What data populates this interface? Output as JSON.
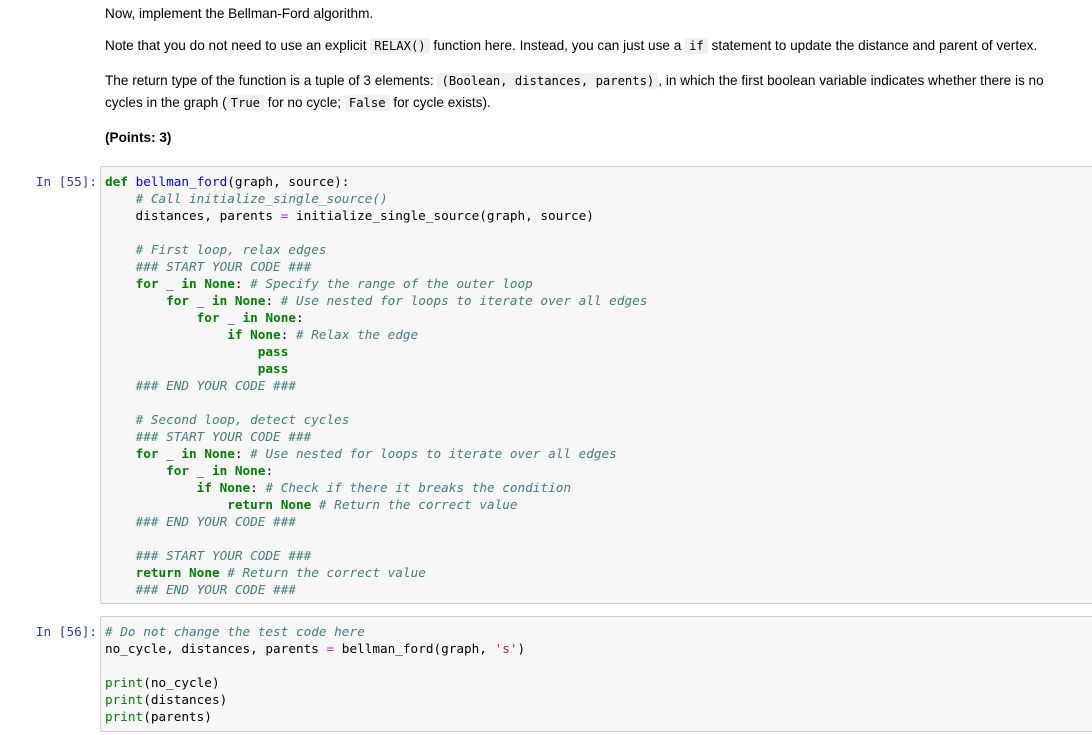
{
  "markdown": {
    "line1": "Now, implement the Bellman-Ford algorithm.",
    "note": {
      "before": "Note that you do not need to use an explicit ",
      "code1": "RELAX()",
      "middle": " function here. Instead, you can just use a ",
      "code2": "if",
      "after": " statement to update the distance and parent of vertex."
    },
    "ret": {
      "before": "The return type of the function is a tuple of 3 elements: ",
      "code1": "(Boolean, distances, parents)",
      "mid1": ", in which the first boolean variable indicates whether there is no cycles in the graph (",
      "code2": "True",
      "mid2": " for no cycle; ",
      "code3": "False",
      "after": " for cycle exists)."
    },
    "points": "(Points: 3)"
  },
  "cells": [
    {
      "prompt": "In [55]:"
    },
    {
      "prompt": "In [56]:"
    }
  ]
}
